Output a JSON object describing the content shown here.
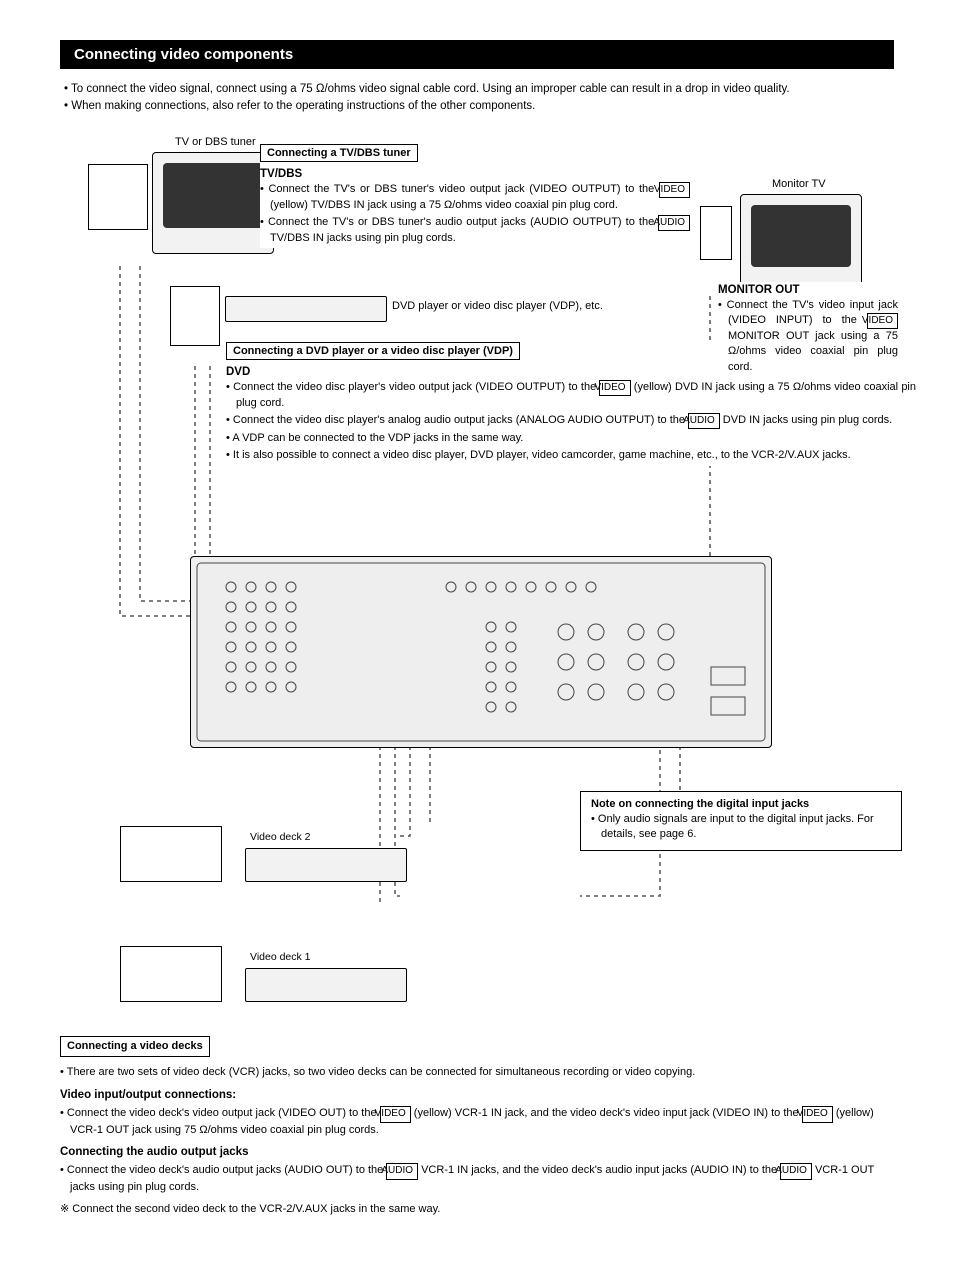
{
  "section_title": "Connecting video components",
  "intro": {
    "bullet1": "To connect the video signal, connect using a 75 Ω/ohms video signal cable cord. Using an improper cable can result in a drop in video quality.",
    "bullet2": "When making connections, also refer to the operating instructions of the other components."
  },
  "labels": {
    "video": "VIDEO",
    "audio": "AUDIO"
  },
  "captions": {
    "tv_dbs_tuner": "TV or DBS tuner",
    "monitor_tv": "Monitor TV",
    "dvd_player_row": "DVD player or video disc player (VDP), etc.",
    "video_deck_2": "Video deck 2",
    "video_deck_1": "Video deck 1"
  },
  "tv_dbs_block": {
    "title": "Connecting a TV/DBS tuner",
    "head": "TV/DBS",
    "b1_a": "Connect the TV's or DBS tuner's video output jack (VIDEO OUTPUT) to the ",
    "b1_b": " (yellow) TV/DBS IN jack using a 75 Ω/ohms video coaxial pin plug cord.",
    "b2_a": "Connect the TV's or DBS tuner's audio output jacks (AUDIO OUTPUT) to the ",
    "b2_b": " TV/DBS IN jacks using pin plug cords."
  },
  "dvd_block": {
    "title": "Connecting a DVD player or a video disc player (VDP)",
    "head": "DVD",
    "b1_a": "Connect the video disc player's video output jack (VIDEO OUTPUT) to the ",
    "b1_b": " (yellow) DVD IN jack using a 75 Ω/ohms video coaxial pin plug cord.",
    "b2_a": "Connect the video disc player's analog audio output jacks (ANALOG AUDIO OUTPUT) to the ",
    "b2_b": " DVD IN jacks using pin plug cords.",
    "b3": "A VDP can be connected to the VDP jacks in the same way.",
    "b4": "It is also possible to connect a video disc player, DVD player, video camcorder, game machine, etc., to the VCR-2/V.AUX jacks."
  },
  "monitor_out_block": {
    "head": "MONITOR OUT",
    "b1_a": "Connect the TV's video input jack (VIDEO INPUT) to the ",
    "b1_b": " MONITOR OUT jack using a 75 Ω/ohms video coaxial pin plug cord."
  },
  "digital_note": {
    "title": "Note on connecting the digital input jacks",
    "body": "Only audio signals are input to the digital input jacks. For details, see page 6."
  },
  "bottom": {
    "title": "Connecting a video decks",
    "p1": "There are two sets of video deck (VCR) jacks, so two video decks can be connected for simultaneous recording or video copying.",
    "head1": "Video input/output connections:",
    "p2_a": "Connect the video deck's video output jack (VIDEO OUT) to the ",
    "p2_b": " (yellow) VCR-1 IN jack, and the video deck's video input jack (VIDEO IN) to the ",
    "p2_c": " (yellow) VCR-1 OUT jack using 75 Ω/ohms video coaxial pin plug cords.",
    "head2": "Connecting the audio output jacks",
    "p3_a": "Connect the video deck's audio output jacks (AUDIO OUT) to the ",
    "p3_b": " VCR-1 IN jacks, and the video deck's audio input jacks (AUDIO IN) to the ",
    "p3_c": " VCR-1 OUT jacks using pin plug cords.",
    "p4": "Connect the second video deck to the VCR-2/V.AUX jacks in the same way."
  }
}
